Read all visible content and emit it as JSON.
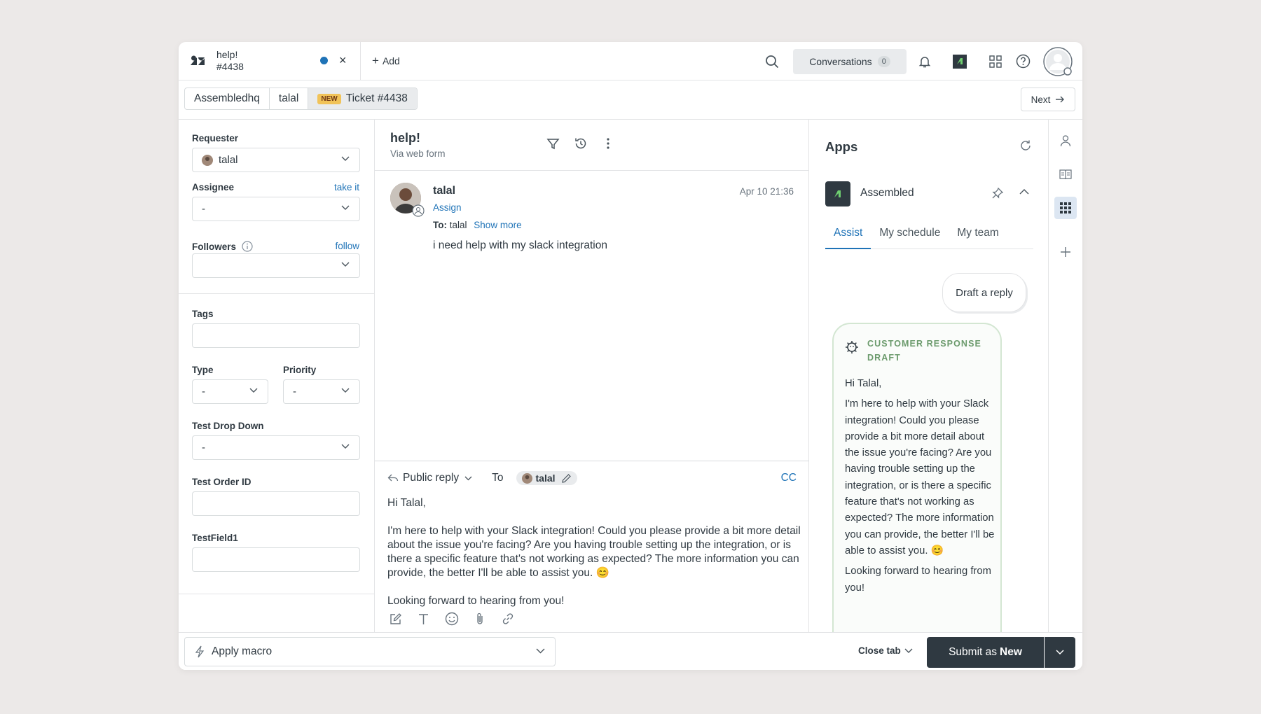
{
  "tab": {
    "title": "help!",
    "number": "#4438"
  },
  "topbar": {
    "add_label": "Add",
    "conversations_label": "Conversations",
    "conversations_count": "0"
  },
  "breadcrumbs": {
    "org": "Assembledhq",
    "user": "talal",
    "new_badge": "NEW",
    "ticket": "Ticket #4438",
    "next_label": "Next"
  },
  "props": {
    "requester_label": "Requester",
    "requester_value": "talal",
    "assignee_label": "Assignee",
    "assignee_link": "take it",
    "assignee_value": "-",
    "followers_label": "Followers",
    "followers_link": "follow",
    "tags_label": "Tags",
    "type_label": "Type",
    "type_value": "-",
    "priority_label": "Priority",
    "priority_value": "-",
    "dropdown_label": "Test Drop Down",
    "dropdown_value": "-",
    "orderid_label": "Test Order ID",
    "testfield_label": "TestField1"
  },
  "conversation": {
    "subject": "help!",
    "via": "Via web form",
    "author": "talal",
    "assign_link": "Assign",
    "to_label": "To:",
    "to_value": "talal",
    "show_more": "Show more",
    "date": "Apr 10 21:36",
    "body": "i need help with my slack integration"
  },
  "composer": {
    "reply_type": "Public reply",
    "to_label": "To",
    "recipient": "talal",
    "cc_label": "CC",
    "greeting": "Hi Talal,",
    "paragraph": "I'm here to help with your Slack integration! Could you please provide a bit more detail about the issue you're facing? Are you having trouble setting up the integration, or is there a specific feature that's not working as expected? The more information you can provide, the better I'll be able to assist you. 😊",
    "closing": "Looking forward to hearing from you!"
  },
  "apps": {
    "title": "Apps",
    "app_name": "Assembled",
    "tabs": [
      "Assist",
      "My schedule",
      "My team"
    ],
    "draft_button": "Draft a reply",
    "card_heading": "CUSTOMER RESPONSE DRAFT",
    "card_greeting": "Hi Talal,",
    "card_paragraph": "I'm here to help with your Slack integration! Could you please provide a bit more detail about the issue you're facing? Are you having trouble setting up the integration, or is there a specific feature that's not working as expected? The more information you can provide, the better I'll be able to assist you. 😊",
    "card_closing": "Looking forward to hearing from you!"
  },
  "bottom": {
    "macro_label": "Apply macro",
    "close_tab": "Close tab",
    "submit_label": "Submit as",
    "submit_status": "New"
  },
  "colors": {
    "accent": "#1f73b7",
    "dark": "#2f3941",
    "unread_dot": "#1f73b7",
    "card_border": "#d3e6d2",
    "new_badge": "#f1c359"
  }
}
